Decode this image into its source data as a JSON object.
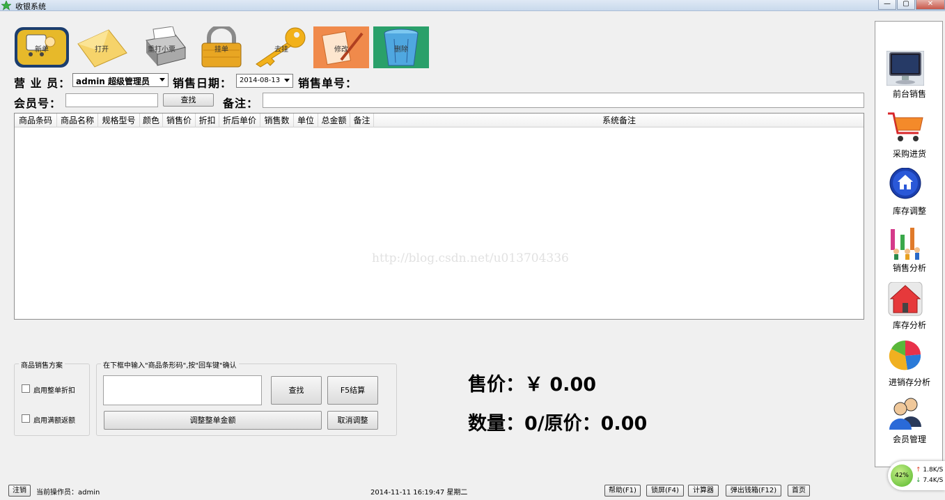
{
  "window": {
    "title": "收银系统",
    "min_btn": "—",
    "max_btn": "▢",
    "close_btn": "✕"
  },
  "toolbar": {
    "new": "新单",
    "open": "打开",
    "reprint": "重打小票",
    "hang": "挂单",
    "unhang": "去挂",
    "modify": "修改",
    "delete": "删除"
  },
  "form": {
    "clerk_label": "营 业 员：",
    "clerk_value": "admin 超级管理员",
    "date_label": "销售日期：",
    "date_value": "2014-08-13",
    "order_label": "销售单号：",
    "member_label": "会员号：",
    "member_value": "",
    "find_btn": "查找",
    "remark_label": "备注：",
    "remark_value": ""
  },
  "grid": {
    "columns": [
      "商品条码",
      "商品名称",
      "规格型号",
      "颜色",
      "销售价",
      "折扣",
      "折后单价",
      "销售数",
      "单位",
      "总金额",
      "备注",
      "系统备注"
    ],
    "rows": [],
    "watermark": "http://blog.csdn.net/u013704336"
  },
  "plan": {
    "caption": "商品销售方案",
    "opt1": "启用整单折扣",
    "opt2": "启用满额返额",
    "opt1_checked": false,
    "opt2_checked": false
  },
  "entry": {
    "caption": "在下框中输入\"商品条形码\",按\"回车键\"确认",
    "find_btn": "查找",
    "settle_btn": "F5结算",
    "adjust_btn": "调整整单金额",
    "cancel_adjust_btn": "取消调整"
  },
  "totals": {
    "price_line": "售价：￥ 0.00",
    "qty_line": "数量：0/原价：0.00"
  },
  "nav": {
    "items": [
      {
        "label": "前台销售",
        "icon": "monitor-icon"
      },
      {
        "label": "采购进货",
        "icon": "cart-icon"
      },
      {
        "label": "库存调整",
        "icon": "home-icon"
      },
      {
        "label": "销售分析",
        "icon": "people-chart-icon"
      },
      {
        "label": "库存分析",
        "icon": "house-icon"
      },
      {
        "label": "进销存分析",
        "icon": "pie-chart-icon"
      },
      {
        "label": "会员管理",
        "icon": "users-icon"
      }
    ]
  },
  "status": {
    "logout_btn": "注销",
    "operator": "当前操作员：admin",
    "datetime": "2014-11-11 16:19:47 星期二",
    "help_btn": "帮助(F1)",
    "lock_btn": "锁屏(F4)",
    "calc_btn": "计算器",
    "drawer_btn": "弹出钱箱(F12)",
    "home_btn": "首页"
  },
  "netmon": {
    "percent": "42%",
    "up": "1.8K/S",
    "down": "7.4K/S"
  },
  "colors": {
    "accent": "#2a6fd6",
    "titlebar": "#c9d9ec"
  }
}
